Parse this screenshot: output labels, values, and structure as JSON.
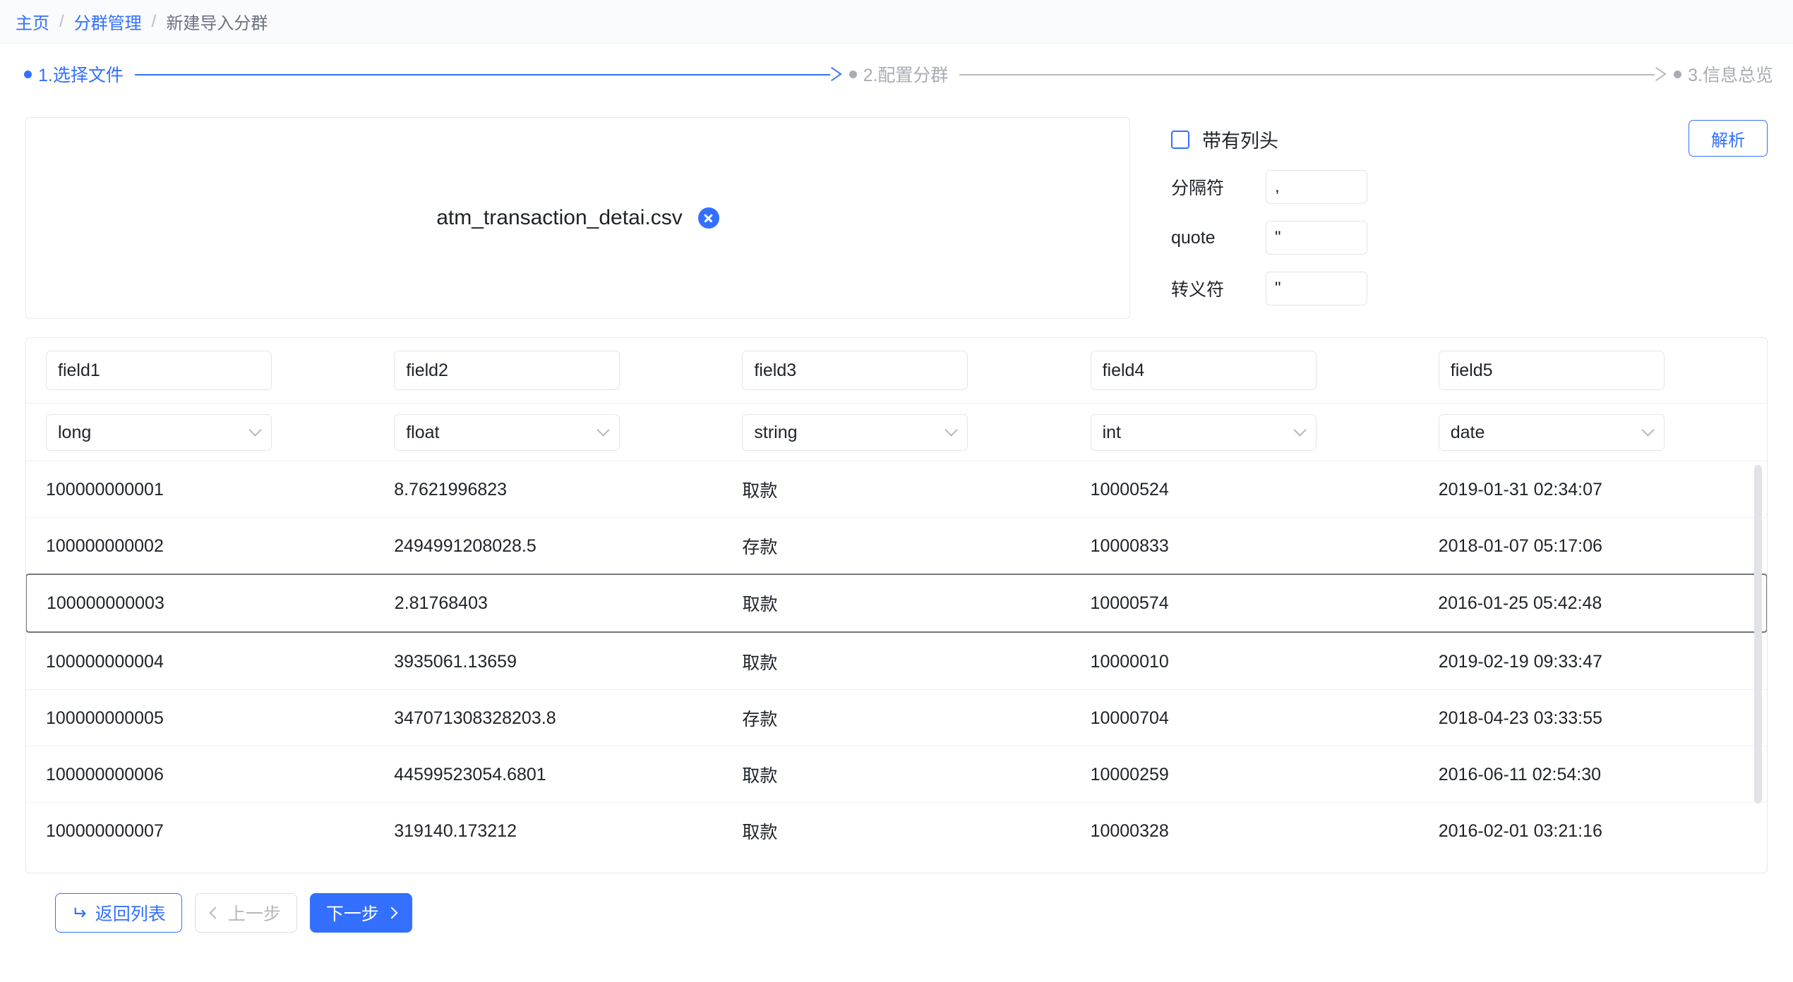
{
  "breadcrumb": {
    "items": [
      {
        "label": "主页",
        "type": "link"
      },
      {
        "label": "分群管理",
        "type": "link"
      },
      {
        "label": "新建导入分群",
        "type": "current"
      }
    ],
    "separator": "/"
  },
  "stepper": {
    "steps": [
      {
        "label": "1.选择文件",
        "state": "active"
      },
      {
        "label": "2.配置分群",
        "state": "idle"
      },
      {
        "label": "3.信息总览",
        "state": "idle"
      }
    ]
  },
  "upload": {
    "file_name": "atm_transaction_detai.csv",
    "delete_icon": "close-circle-icon"
  },
  "settings": {
    "header_checkbox": {
      "label": "带有列头",
      "checked": false
    },
    "parse_button": "解析",
    "fields": [
      {
        "label": "分隔符",
        "value": ","
      },
      {
        "label": "quote",
        "value": "\""
      },
      {
        "label": "转义符",
        "value": "\""
      }
    ]
  },
  "table": {
    "field_names": [
      "field1",
      "field2",
      "field3",
      "field4",
      "field5"
    ],
    "field_types": [
      "long",
      "float",
      "string",
      "int",
      "date"
    ],
    "type_options": [
      "long",
      "float",
      "string",
      "int",
      "date"
    ],
    "rows": [
      {
        "selected": false,
        "cells": [
          "100000000001",
          "8.7621996823",
          "取款",
          "10000524",
          "2019-01-31 02:34:07"
        ]
      },
      {
        "selected": false,
        "cells": [
          "100000000002",
          "2494991208028.5",
          "存款",
          "10000833",
          "2018-01-07 05:17:06"
        ]
      },
      {
        "selected": true,
        "cells": [
          "100000000003",
          "2.81768403",
          "取款",
          "10000574",
          "2016-01-25 05:42:48"
        ]
      },
      {
        "selected": false,
        "cells": [
          "100000000004",
          "3935061.13659",
          "取款",
          "10000010",
          "2019-02-19 09:33:47"
        ]
      },
      {
        "selected": false,
        "cells": [
          "100000000005",
          "347071308328203.8",
          "存款",
          "10000704",
          "2018-04-23 03:33:55"
        ]
      },
      {
        "selected": false,
        "cells": [
          "100000000006",
          "44599523054.6801",
          "取款",
          "10000259",
          "2016-06-11 02:54:30"
        ]
      },
      {
        "selected": false,
        "cells": [
          "100000000007",
          "319140.173212",
          "取款",
          "10000328",
          "2016-02-01 03:21:16"
        ]
      }
    ]
  },
  "footer": {
    "back_to_list": "返回列表",
    "prev_step": "上一步",
    "next_step": "下一步",
    "back_icon": "undo-arrow-icon",
    "prev_icon": "chevron-left-icon",
    "next_icon": "chevron-right-icon"
  },
  "colors": {
    "accent": "#3370ff",
    "muted": "#a9acb4",
    "text": "#1f2329",
    "border": "#e6e8eb",
    "selected_border": "#76787d"
  }
}
